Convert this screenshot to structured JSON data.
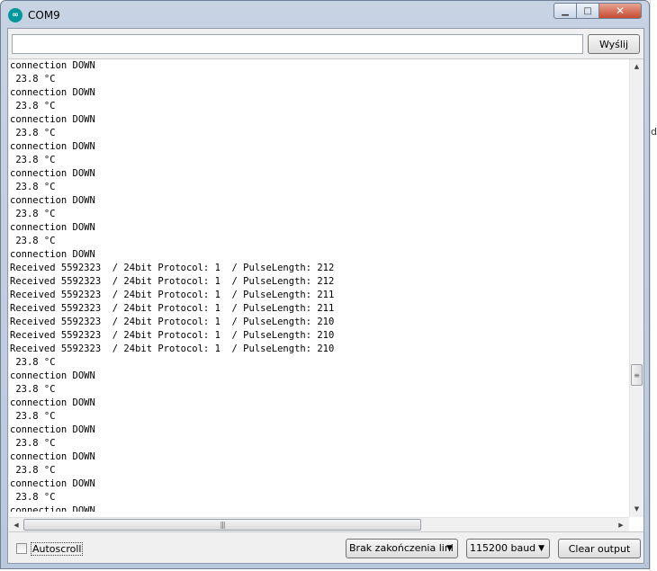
{
  "window": {
    "title": "COM9",
    "icon": "arduino-icon",
    "close_glyph": "✕"
  },
  "toolbar": {
    "send_input_value": "",
    "send_label": "Wyślij"
  },
  "output": {
    "lines": [
      "connection DOWN",
      " 23.8 °C",
      "connection DOWN",
      " 23.8 °C",
      "connection DOWN",
      " 23.8 °C",
      "connection DOWN",
      " 23.8 °C",
      "connection DOWN",
      " 23.8 °C",
      "connection DOWN",
      " 23.8 °C",
      "connection DOWN",
      " 23.8 °C",
      "connection DOWN",
      "Received 5592323  / 24bit Protocol: 1  / PulseLength: 212",
      "Received 5592323  / 24bit Protocol: 1  / PulseLength: 212",
      "Received 5592323  / 24bit Protocol: 1  / PulseLength: 211",
      "Received 5592323  / 24bit Protocol: 1  / PulseLength: 211",
      "Received 5592323  / 24bit Protocol: 1  / PulseLength: 210",
      "Received 5592323  / 24bit Protocol: 1  / PulseLength: 210",
      "Received 5592323  / 24bit Protocol: 1  / PulseLength: 210",
      " 23.8 °C",
      "connection DOWN",
      " 23.8 °C",
      "connection DOWN",
      " 23.8 °C",
      "connection DOWN",
      " 23.8 °C",
      "connection DOWN",
      " 23.8 °C",
      "connection DOWN",
      " 23.8 °C",
      "connection DOWN",
      " 23.8 °C"
    ]
  },
  "bottom": {
    "autoscroll_label": "Autoscroll",
    "autoscroll_checked": false,
    "line_ending_selected": "Brak zakończenia lini",
    "baud_selected": "115200 baud",
    "clear_label": "Clear output"
  },
  "right_strip_text": "ıd"
}
